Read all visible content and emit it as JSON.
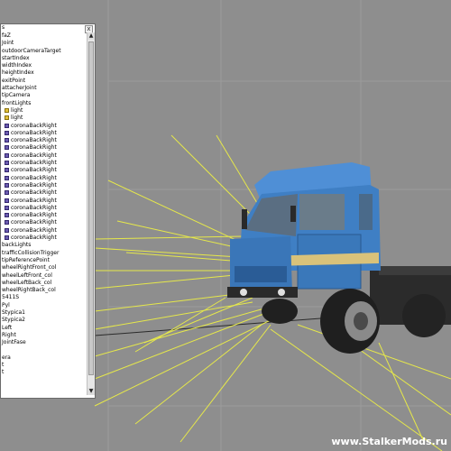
{
  "panel": {
    "title": "s",
    "close_glyph": "x",
    "items": [
      {
        "label": "faZ",
        "indent": 0,
        "icon": null
      },
      {
        "label": "Joint",
        "indent": 0,
        "icon": null
      },
      {
        "label": "outdoorCameraTarget",
        "indent": 0,
        "icon": null
      },
      {
        "label": "startIndex",
        "indent": 0,
        "icon": null
      },
      {
        "label": "widthIndex",
        "indent": 0,
        "icon": null
      },
      {
        "label": "heightIndex",
        "indent": 0,
        "icon": null
      },
      {
        "label": "exitPoint",
        "indent": 0,
        "icon": null
      },
      {
        "label": "attacherJoint",
        "indent": 0,
        "icon": null
      },
      {
        "label": "tipCamera",
        "indent": 0,
        "icon": null
      },
      {
        "label": "frontLights",
        "indent": 0,
        "icon": null
      },
      {
        "label": "light",
        "indent": 1,
        "icon": "light"
      },
      {
        "label": "light",
        "indent": 1,
        "icon": "light"
      },
      {
        "label": "coronaBackRight",
        "indent": 1,
        "icon": "corona"
      },
      {
        "label": "coronaBackRight",
        "indent": 1,
        "icon": "corona"
      },
      {
        "label": "coronaBackRight",
        "indent": 1,
        "icon": "corona"
      },
      {
        "label": "coronaBackRight",
        "indent": 1,
        "icon": "corona"
      },
      {
        "label": "coronaBackRight",
        "indent": 1,
        "icon": "corona"
      },
      {
        "label": "coronaBackRight",
        "indent": 1,
        "icon": "corona"
      },
      {
        "label": "coronaBackRight",
        "indent": 1,
        "icon": "corona"
      },
      {
        "label": "coronaBackRight",
        "indent": 1,
        "icon": "corona"
      },
      {
        "label": "coronaBackRight",
        "indent": 1,
        "icon": "corona"
      },
      {
        "label": "coronaBackRight",
        "indent": 1,
        "icon": "corona"
      },
      {
        "label": "coronaBackRight",
        "indent": 1,
        "icon": "corona"
      },
      {
        "label": "coronaBackRight",
        "indent": 1,
        "icon": "corona"
      },
      {
        "label": "coronaBackRight",
        "indent": 1,
        "icon": "corona"
      },
      {
        "label": "coronaBackRight",
        "indent": 1,
        "icon": "corona"
      },
      {
        "label": "coronaBackRight",
        "indent": 1,
        "icon": "corona"
      },
      {
        "label": "coronaBackRight",
        "indent": 1,
        "icon": "corona"
      },
      {
        "label": "backLights",
        "indent": 0,
        "icon": null
      },
      {
        "label": "trafficCollisionTrigger",
        "indent": 0,
        "icon": null
      },
      {
        "label": "tipReferencePoint",
        "indent": 0,
        "icon": null
      },
      {
        "label": "wheelRightFront_col",
        "indent": 0,
        "icon": null
      },
      {
        "label": "wheelLeftFront_col",
        "indent": 0,
        "icon": null
      },
      {
        "label": "wheelLeftBack_col",
        "indent": 0,
        "icon": null
      },
      {
        "label": "wheelRightBack_col",
        "indent": 0,
        "icon": null
      },
      {
        "label": "5411S",
        "indent": 0,
        "icon": null
      },
      {
        "label": "Pyl",
        "indent": 0,
        "icon": null
      },
      {
        "label": "Stypica1",
        "indent": 0,
        "icon": null
      },
      {
        "label": "Stypica2",
        "indent": 0,
        "icon": null
      },
      {
        "label": "Left",
        "indent": 0,
        "icon": null
      },
      {
        "label": "Right",
        "indent": 0,
        "icon": null
      },
      {
        "label": "JointFase",
        "indent": 0,
        "icon": null
      },
      {
        "label": "",
        "indent": 0,
        "icon": null
      },
      {
        "label": "era",
        "indent": 0,
        "icon": null
      },
      {
        "label": "t",
        "indent": 0,
        "icon": null
      },
      {
        "label": "t",
        "indent": 0,
        "icon": null
      }
    ]
  },
  "watermark": "www.StalkerMods.ru",
  "colors": {
    "viewport_bg": "#8e8e8e",
    "grid_line": "#9c9c9c",
    "helper_line": "#e6e84a",
    "cab_blue": "#3f7fc4",
    "stripe_yellow": "#d9c27a"
  }
}
